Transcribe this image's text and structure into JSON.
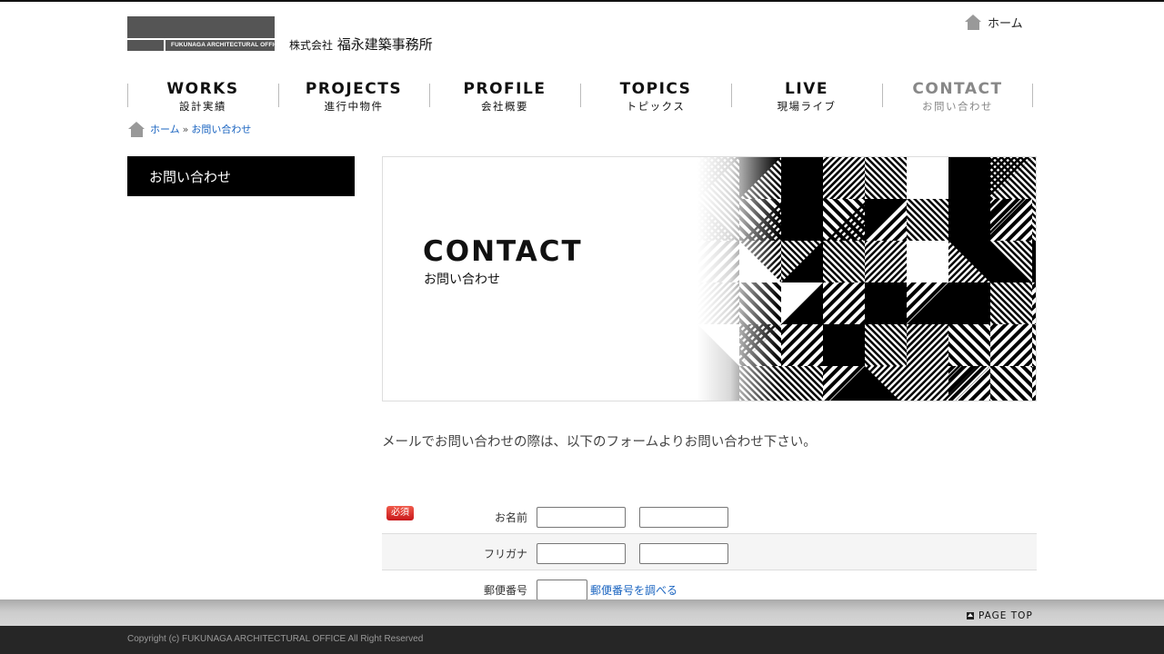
{
  "header": {
    "logo_text": "FUKUNAGA ARCHITECTURAL OFFICE",
    "company_prefix": "株式会社",
    "company_name": "福永建築事務所",
    "home_label": "ホーム"
  },
  "nav": [
    {
      "en": "WORKS",
      "jp": "設計実績"
    },
    {
      "en": "PROJECTS",
      "jp": "進行中物件"
    },
    {
      "en": "PROFILE",
      "jp": "会社概要"
    },
    {
      "en": "TOPICS",
      "jp": "トピックス"
    },
    {
      "en": "LIVE",
      "jp": "現場ライブ"
    },
    {
      "en": "CONTACT",
      "jp": "お問い合わせ",
      "active": true
    }
  ],
  "breadcrumb": {
    "home": "ホーム",
    "separator": "»",
    "current": "お問い合わせ"
  },
  "sidebar": {
    "title": "お問い合わせ"
  },
  "hero": {
    "title": "CONTACT",
    "subtitle": "お問い合わせ"
  },
  "intro": "メールでお問い合わせの際は、以下のフォームよりお問い合わせ下さい。",
  "form": {
    "required_badge": "必須",
    "name_label": "お名前",
    "furigana_label": "フリガナ",
    "zip_label": "郵便番号",
    "zip_lookup": "郵便番号を調べる"
  },
  "footer": {
    "page_top": "PAGE TOP",
    "copyright": "Copyright (c) FUKUNAGA ARCHITECTURAL OFFICE All Right Reserved"
  },
  "colors": {
    "link": "#1a64c0",
    "required": "#d42a22",
    "footer_bg": "#262626"
  }
}
